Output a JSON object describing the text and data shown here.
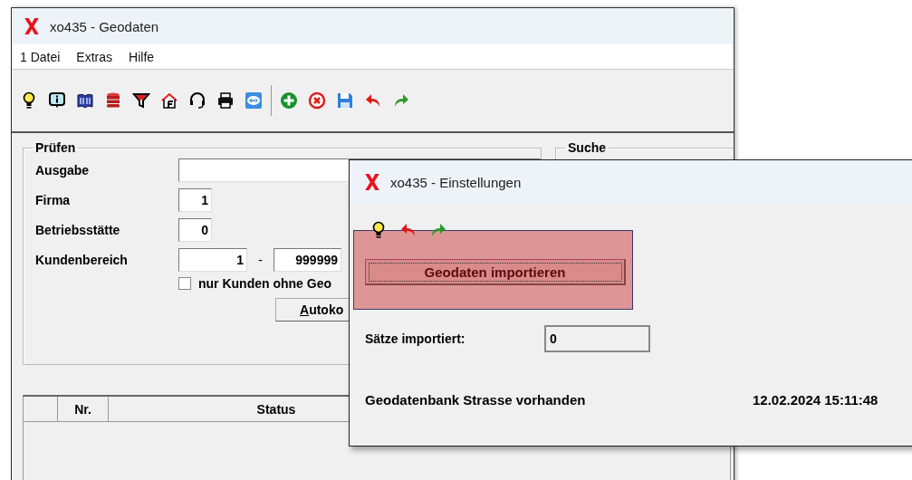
{
  "main_window": {
    "title": "xo435 - Geodaten",
    "menu": [
      "1 Datei",
      "Extras",
      "Hilfe"
    ],
    "pruefen": {
      "title": "Prüfen",
      "fields": [
        {
          "kind": "wide",
          "label": "Ausgabe"
        },
        {
          "kind": "small",
          "label": "Firma",
          "value": "1"
        },
        {
          "kind": "small",
          "label": "Betriebsstätte",
          "value": "0"
        },
        {
          "kind": "range",
          "label": "Kundenbereich",
          "from": "1",
          "separator": "-",
          "to": "999999"
        }
      ],
      "checkbox": {
        "label": "nur Kunden ohne Geo",
        "checked": false
      },
      "button": "Autoko"
    },
    "suche": {
      "title": "Suche"
    },
    "table": {
      "columns": [
        "Nr.",
        "Status"
      ]
    }
  },
  "dialog": {
    "title": "xo435 - Einstellungen",
    "import_button": "Geodaten importieren",
    "imported": {
      "label": "Sätze importiert:",
      "value": "0"
    },
    "status": {
      "text": "Geodatenbank Strasse vorhanden",
      "timestamp": "12.02.2024 15:11:48"
    }
  }
}
